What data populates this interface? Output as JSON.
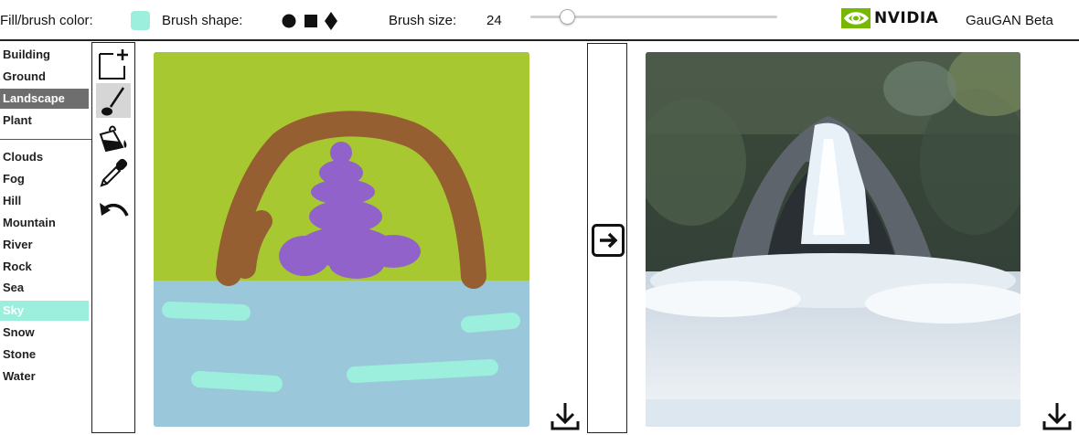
{
  "topbar": {
    "fill_color_label": "Fill/brush color:",
    "fill_color": "#9ceedd",
    "brush_shape_label": "Brush shape:",
    "brush_shapes": [
      "circle-icon",
      "square-icon",
      "diamond-icon"
    ],
    "brush_size_label": "Brush size:",
    "brush_size_value": "24",
    "brush_size_fraction": 0.15,
    "brand": "NVIDIA",
    "app_title": "GauGAN Beta"
  },
  "labels": {
    "group1": [
      "Building",
      "Ground",
      "Landscape",
      "Plant"
    ],
    "group2": [
      "Clouds",
      "Fog",
      "Hill",
      "Mountain",
      "River",
      "Rock",
      "Sea",
      "Sky",
      "Snow",
      "Stone",
      "Water"
    ],
    "selected": "Landscape",
    "fill_selected": "Sky"
  },
  "tools": [
    "new-canvas-icon",
    "brush-icon",
    "fill-bucket-icon",
    "eyedropper-icon",
    "undo-icon"
  ],
  "colors": {
    "grass": "#a7c831",
    "dirt": "#955f31",
    "rock": "#9162c9",
    "water": "#9ac7d9",
    "sky": "#9ceedd",
    "landscape_selected": "#6e6e6e"
  }
}
